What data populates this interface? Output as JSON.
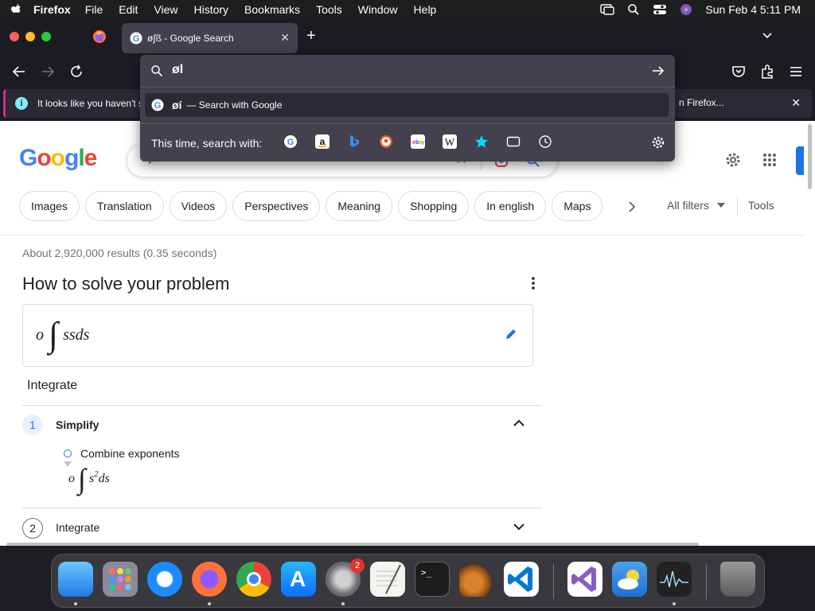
{
  "menubar": {
    "app_name": "Firefox",
    "menus": [
      "File",
      "Edit",
      "View",
      "History",
      "Bookmarks",
      "Tools",
      "Window",
      "Help"
    ],
    "clock": "Sun Feb 4  5:11 PM"
  },
  "tab": {
    "title": "ø∫ß - Google Search"
  },
  "notification": {
    "text": "It looks like you haven't st",
    "right_text": "n Firefox..."
  },
  "urlbar": {
    "value": "øl",
    "suggestion_query": "øí",
    "suggestion_action": "— Search with Google",
    "this_time": "This time, search with:"
  },
  "google": {
    "logo": "Google",
    "search_value": "ø∫ß"
  },
  "chips": [
    "Images",
    "Translation",
    "Videos",
    "Perspectives",
    "Meaning",
    "Shopping",
    "In english",
    "Maps"
  ],
  "filters": {
    "all_filters": "All filters",
    "tools": "Tools"
  },
  "results": {
    "stats": "About 2,920,000 results (0.35 seconds)",
    "solver_title": "How to solve your problem",
    "math_left": "o",
    "math_right": "ssds",
    "integrate": "Integrate",
    "step1_num": "1",
    "step1_label": "Simplify",
    "substep_label": "Combine exponents",
    "math2_left": "o",
    "math2_var": "s",
    "math2_exp": "2",
    "math2_tail": "ds",
    "step2_num": "2",
    "step2_label": "Integrate"
  },
  "dock": {
    "settings_badge": "2"
  },
  "colors": {
    "google_blue": "#4285f4",
    "google_red": "#ea4335",
    "google_yellow": "#fbbc05",
    "google_green": "#34a853",
    "firefox_dark": "#1c1b22",
    "panel": "#42414d"
  }
}
